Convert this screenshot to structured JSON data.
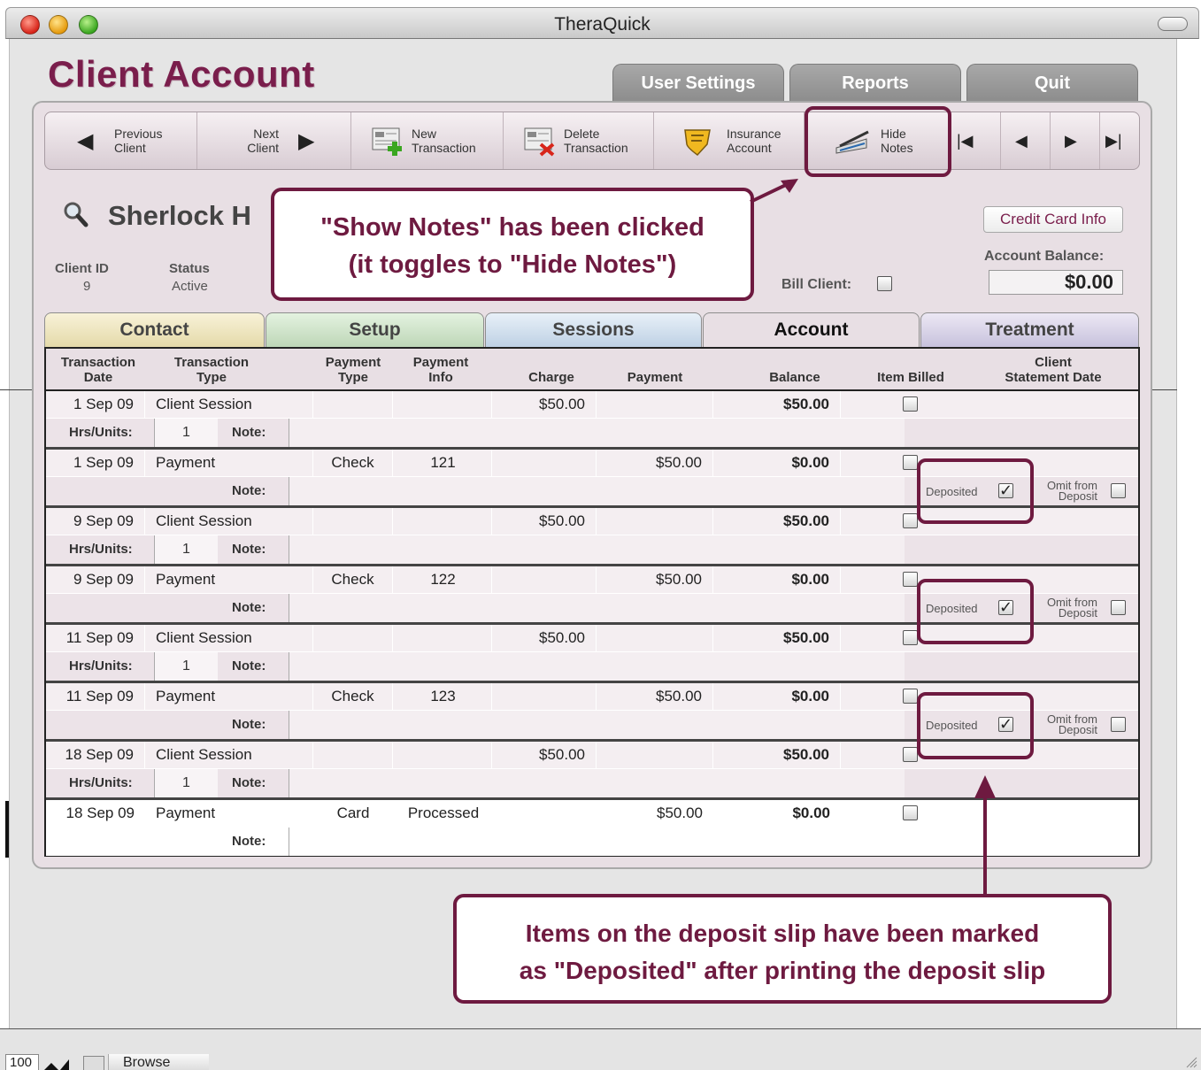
{
  "window": {
    "title": "TheraQuick"
  },
  "page_title": "Client Account",
  "top_tabs": [
    "User Settings",
    "Reports",
    "Quit"
  ],
  "toolbar": {
    "previous_client": [
      "Previous",
      "Client"
    ],
    "next_client": [
      "Next",
      "Client"
    ],
    "new_transaction": [
      "New",
      "Transaction"
    ],
    "delete_transaction": [
      "Delete",
      "Transaction"
    ],
    "insurance_account": [
      "Insurance",
      "Account"
    ],
    "hide_notes": [
      "Hide",
      "Notes"
    ],
    "nav": {
      "first": "|◀",
      "prev": "◀",
      "next": "▶",
      "last": "▶|"
    }
  },
  "client": {
    "name": "Sherlock H",
    "id_label": "Client ID",
    "id_value": "9",
    "status_label": "Status",
    "status_value": "Active",
    "bill_client_label": "Bill Client:",
    "credit_card_button": "Credit Card Info",
    "balance_label": "Account Balance:",
    "balance_value": "$0.00"
  },
  "callouts": {
    "show_notes": [
      "\"Show Notes\" has been clicked",
      "(it toggles to \"Hide Notes\")"
    ],
    "deposited": [
      "Items on the deposit slip have been marked",
      "as \"Deposited\" after printing the deposit slip"
    ]
  },
  "section_tabs": [
    "Contact",
    "Setup",
    "Sessions",
    "Account",
    "Treatment"
  ],
  "columns": {
    "date": [
      "Transaction",
      "Date"
    ],
    "type": [
      "Transaction",
      "Type"
    ],
    "pay_type": [
      "Payment",
      "Type"
    ],
    "pay_info": [
      "Payment",
      "Info"
    ],
    "charge": "Charge",
    "payment": "Payment",
    "balance": "Balance",
    "billed": "Item Billed",
    "stmt": [
      "Client",
      "Statement Date"
    ]
  },
  "labels": {
    "hrs_units": "Hrs/Units:",
    "note": "Note:",
    "deposited": "Deposited",
    "omit": [
      "Omit from",
      "Deposit"
    ]
  },
  "transactions": [
    {
      "date": "1 Sep 09",
      "type": "Client Session",
      "pay_type": "",
      "pay_info": "",
      "charge": "$50.00",
      "payment": "",
      "balance": "$50.00",
      "units": "1"
    },
    {
      "date": "1 Sep 09",
      "type": "Payment",
      "pay_type": "Check",
      "pay_info": "121",
      "charge": "",
      "payment": "$50.00",
      "balance": "$0.00"
    },
    {
      "date": "9 Sep 09",
      "type": "Client Session",
      "pay_type": "",
      "pay_info": "",
      "charge": "$50.00",
      "payment": "",
      "balance": "$50.00",
      "units": "1"
    },
    {
      "date": "9 Sep 09",
      "type": "Payment",
      "pay_type": "Check",
      "pay_info": "122",
      "charge": "",
      "payment": "$50.00",
      "balance": "$0.00"
    },
    {
      "date": "11 Sep 09",
      "type": "Client Session",
      "pay_type": "",
      "pay_info": "",
      "charge": "$50.00",
      "payment": "",
      "balance": "$50.00",
      "units": "1"
    },
    {
      "date": "11 Sep 09",
      "type": "Payment",
      "pay_type": "Check",
      "pay_info": "123",
      "charge": "",
      "payment": "$50.00",
      "balance": "$0.00"
    },
    {
      "date": "18 Sep 09",
      "type": "Client Session",
      "pay_type": "",
      "pay_info": "",
      "charge": "$50.00",
      "payment": "",
      "balance": "$50.00",
      "units": "1"
    },
    {
      "date": "18 Sep 09",
      "type": "Payment",
      "pay_type": "Card",
      "pay_info": "Processed",
      "charge": "",
      "payment": "$50.00",
      "balance": "$0.00"
    }
  ],
  "status_bar": {
    "zoom": "100",
    "mode": "Browse"
  },
  "colors": {
    "accent": "#7a1e4c",
    "panel": "#e8dfe4",
    "callout_border": "#6e1a40"
  }
}
